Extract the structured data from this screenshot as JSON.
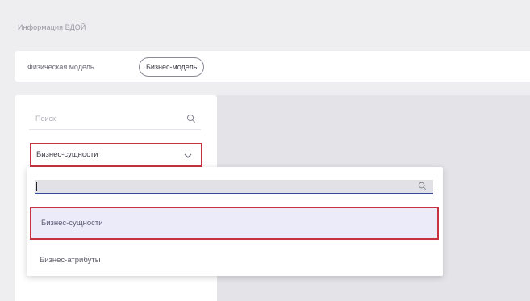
{
  "breadcrumb": {
    "label": "Информация ВДОЙ"
  },
  "tabs": [
    {
      "label": "Физическая модель"
    },
    {
      "label": "Бизнес-модель"
    }
  ],
  "search": {
    "placeholder": "Поиск",
    "icon": "search-icon"
  },
  "select": {
    "value": "Бизнес-сущности",
    "icon": "chevron-down-icon"
  },
  "dropdown": {
    "search_value": "",
    "search_icon": "search-icon",
    "options": [
      {
        "label": "Бизнес-сущности"
      },
      {
        "label": "Бизнес-атрибуты"
      }
    ]
  },
  "colors": {
    "highlight_border": "#c8323e",
    "focus_underline": "#3a4a9a",
    "selected_option_bg": "#ebebfa"
  }
}
